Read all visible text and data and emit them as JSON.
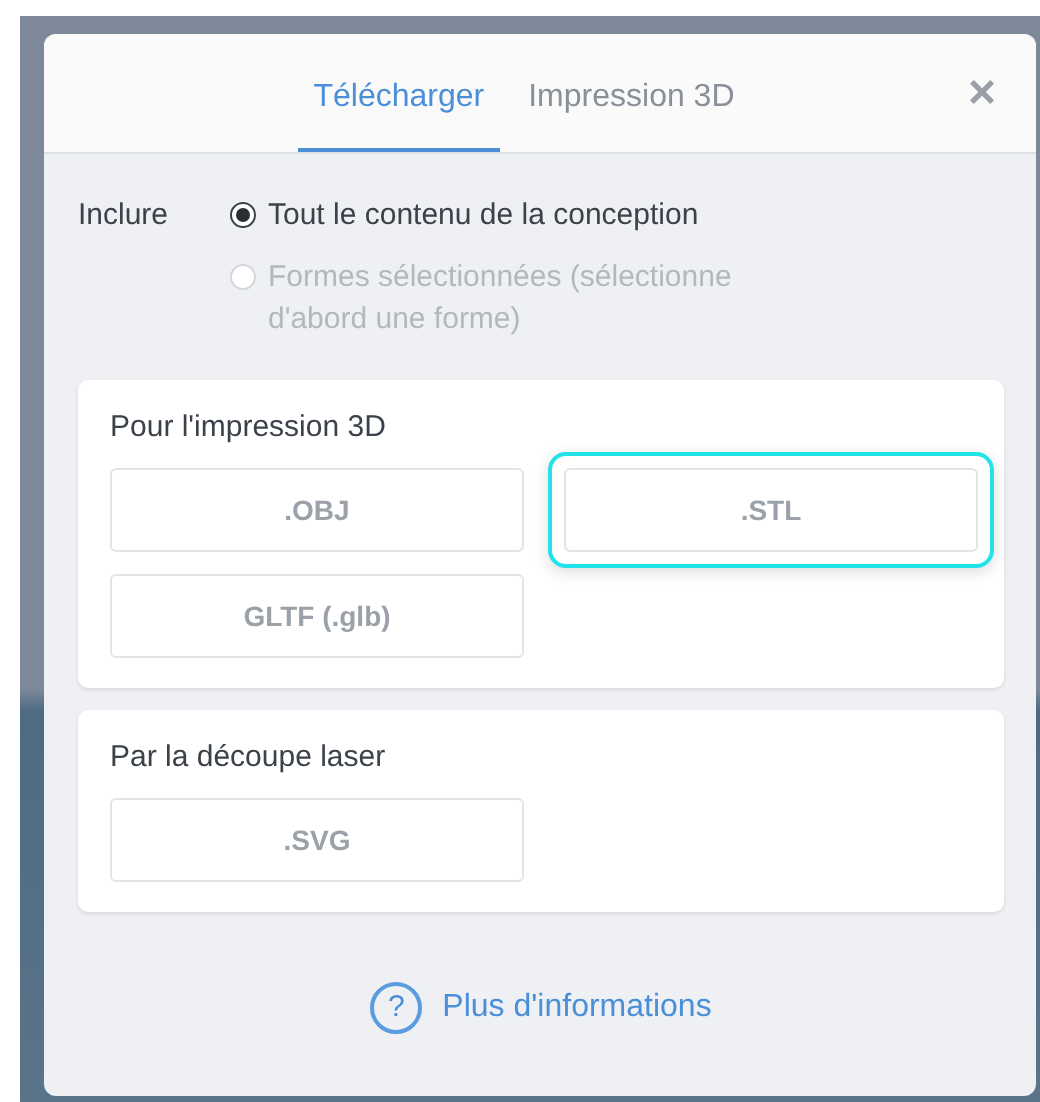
{
  "tabs": [
    {
      "label": "Télécharger",
      "selected": true
    },
    {
      "label": "Impression 3D",
      "selected": false
    }
  ],
  "close": "×",
  "include": {
    "label": "Inclure",
    "options": [
      {
        "label": "Tout le contenu de la conception",
        "selected": true,
        "disabled": false
      },
      {
        "label": "Formes sélectionnées (sélectionne d'abord une forme)",
        "selected": false,
        "disabled": true
      }
    ]
  },
  "sections": [
    {
      "title": "Pour l'impression 3D",
      "formats": [
        {
          "label": ".OBJ",
          "selected": false
        },
        {
          "label": ".STL",
          "selected": true
        },
        {
          "label": "GLTF (.glb)",
          "selected": false
        }
      ]
    },
    {
      "title": "Par la découpe laser",
      "formats": [
        {
          "label": ".SVG",
          "selected": false
        }
      ]
    }
  ],
  "help": {
    "icon": "?",
    "label": "Plus d'informations"
  }
}
